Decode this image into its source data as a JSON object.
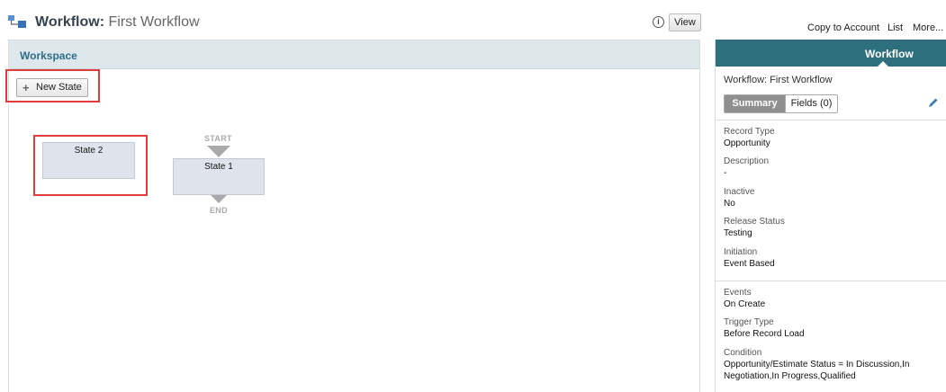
{
  "header": {
    "title_bold": "Workflow:",
    "title_name": "First Workflow",
    "info_icon": "i",
    "view_label": "View",
    "links": {
      "copy": "Copy to Account",
      "list": "List",
      "more": "More..."
    }
  },
  "workspace": {
    "title": "Workspace",
    "new_state_label": "New State",
    "start_label": "START",
    "end_label": "END",
    "states": [
      "State 2",
      "State 1"
    ]
  },
  "panel": {
    "tab": "Workflow",
    "workflow_title": "Workflow: First Workflow",
    "tabs": {
      "summary": "Summary",
      "fields": "Fields (0)"
    },
    "fields": {
      "record_type": {
        "label": "Record Type",
        "value": "Opportunity"
      },
      "description": {
        "label": "Description",
        "value": "-"
      },
      "inactive": {
        "label": "Inactive",
        "value": "No"
      },
      "release_status": {
        "label": "Release Status",
        "value": "Testing"
      },
      "initiation": {
        "label": "Initiation",
        "value": "Event Based"
      },
      "events": {
        "label": "Events",
        "value": "On Create"
      },
      "trigger_type": {
        "label": "Trigger Type",
        "value": "Before Record Load"
      },
      "condition": {
        "label": "Condition",
        "value_line1": "Opportunity/Estimate Status = In Discussion,In",
        "value_line2": "Negotiation,In Progress,Qualified"
      }
    }
  },
  "colors": {
    "panel_header": "#2e6f7e",
    "workspace_header": "#dde7ec",
    "highlight": "#e23b3b",
    "state_fill": "#dfe4ec"
  }
}
